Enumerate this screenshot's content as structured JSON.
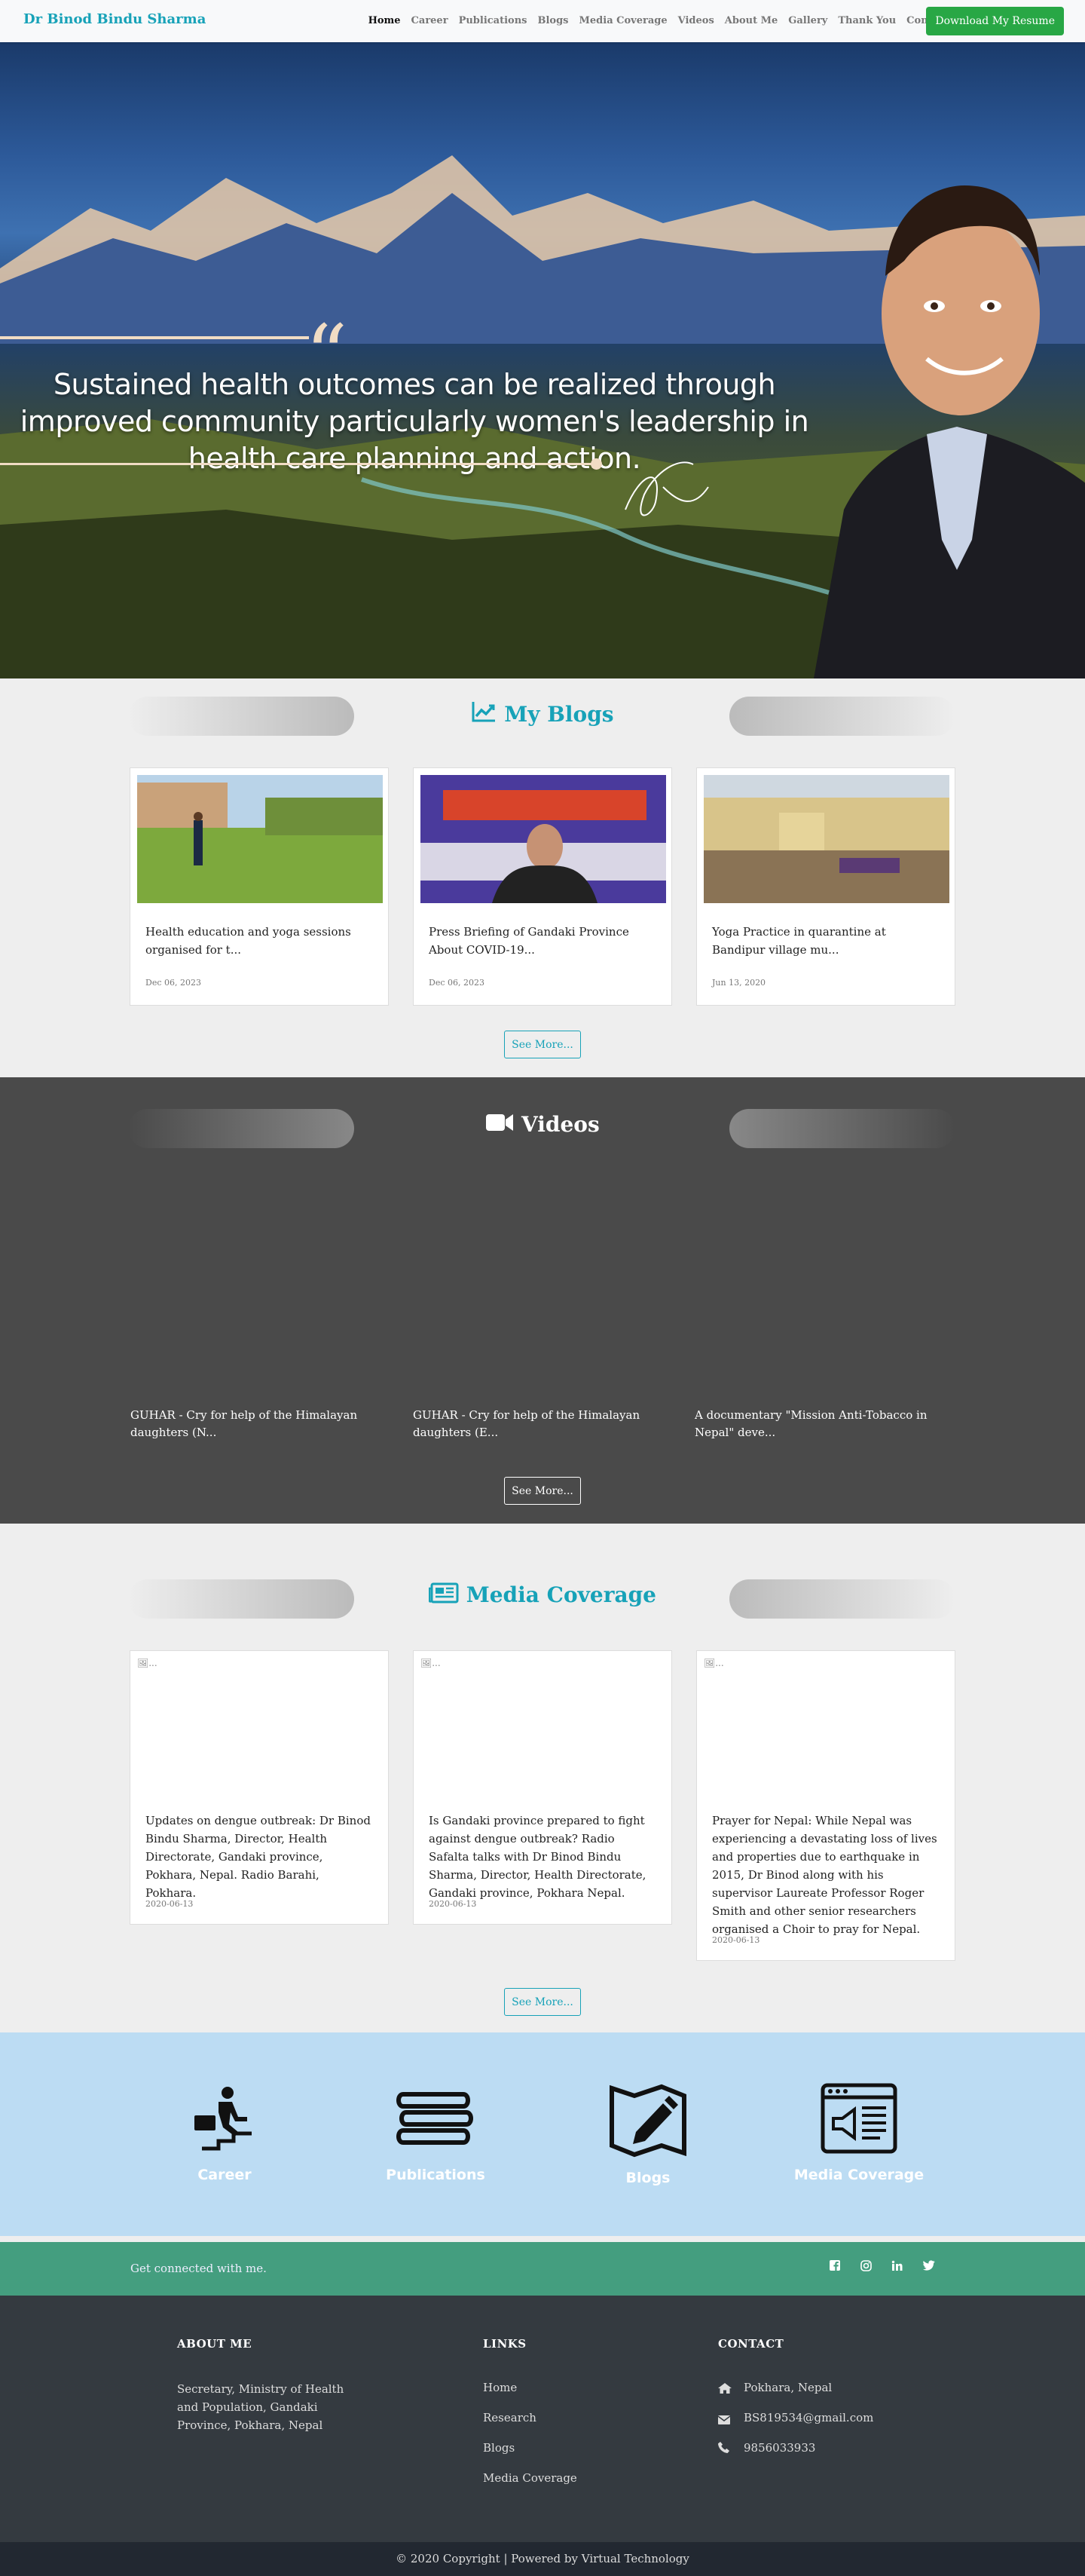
{
  "nav": {
    "brand": "Dr Binod Bindu Sharma",
    "links": [
      "Home",
      "Career",
      "Publications",
      "Blogs",
      "Media Coverage",
      "Videos",
      "About Me",
      "Gallery",
      "Thank You",
      "Contact"
    ],
    "resume_button": "Download My Resume"
  },
  "hero": {
    "quote": "Sustained health outcomes can be realized through improved community particularly women's leadership in health care planning and action."
  },
  "blogs": {
    "title": "My Blogs",
    "icon": "chart-line-icon",
    "cards": [
      {
        "title": "Health education and yoga sessions organised for t...",
        "date": "Dec 06, 2023"
      },
      {
        "title": "Press Briefing of Gandaki Province About COVID-19...",
        "date": "Dec 06, 2023"
      },
      {
        "title": "Yoga Practice in quarantine at Bandipur village mu...",
        "date": "Jun 13, 2020"
      }
    ],
    "see_more": "See More..."
  },
  "videos": {
    "title": "Videos",
    "icon": "video-camera-icon",
    "items": [
      {
        "title": "GUHAR - Cry for help of the Himalayan daughters (N..."
      },
      {
        "title": "GUHAR - Cry for help of the Himalayan daughters (E..."
      },
      {
        "title": "A documentary \"Mission Anti-Tobacco in Nepal\" deve..."
      }
    ],
    "see_more": "See More..."
  },
  "media": {
    "title": "Media Coverage",
    "icon": "newspaper-icon",
    "cards": [
      {
        "alt": "...",
        "title": "Updates on dengue outbreak: Dr Binod Bindu Sharma, Director, Health Directorate, Gandaki province, Pokhara, Nepal. Radio Barahi, Pokhara.",
        "date": "2020-06-13"
      },
      {
        "alt": "...",
        "title": "Is Gandaki province prepared to fight against dengue outbreak? Radio Safalta talks with Dr Binod Bindu Sharma, Director, Health Directorate, Gandaki province, Pokhara Nepal.",
        "date": "2020-06-13"
      },
      {
        "alt": "...",
        "title": "Prayer for Nepal: While Nepal was experiencing a devastating loss of lives and properties due to earthquake in 2015, Dr Binod along with his supervisor Laureate Professor Roger Smith and other senior researchers organised a Choir to pray for Nepal.",
        "date": "2020-06-13"
      }
    ],
    "see_more": "See More..."
  },
  "quick_links": [
    {
      "label": "Career",
      "icon": "career-stairs-icon"
    },
    {
      "label": "Publications",
      "icon": "books-icon"
    },
    {
      "label": "Blogs",
      "icon": "map-pen-icon"
    },
    {
      "label": "Media Coverage",
      "icon": "megaphone-browser-icon"
    }
  ],
  "connect": {
    "text": "Get connected with me.",
    "icons": [
      "facebook-icon",
      "instagram-icon",
      "linkedin-icon",
      "twitter-icon"
    ]
  },
  "footer": {
    "about_heading": "ABOUT ME",
    "about_text": "Secretary, Ministry of Health and Population, Gandaki Province, Pokhara, Nepal",
    "links_heading": "LINKS",
    "links": [
      "Home",
      "Research",
      "Blogs",
      "Media Coverage"
    ],
    "contact_heading": "CONTACT",
    "location": "Pokhara, Nepal",
    "email": "BS819534@gmail.com",
    "phone": "9856033933",
    "copyright": "© 2020 Copyright | Powered by Virtual Technology"
  },
  "colors": {
    "brand": "#17a2b8",
    "success": "#28a745",
    "connect_band": "#449e7f",
    "footer": "#343a40"
  }
}
